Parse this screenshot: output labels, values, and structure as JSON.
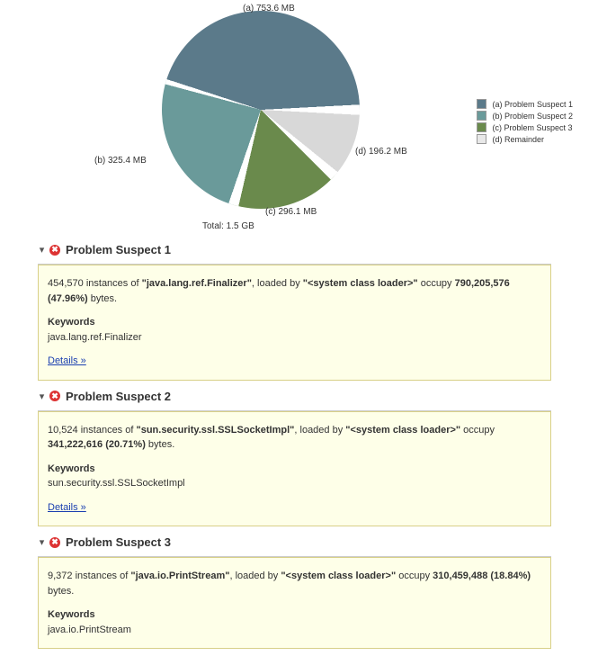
{
  "chart_data": {
    "type": "pie",
    "title": "",
    "series": [
      {
        "key": "a",
        "name": "Problem Suspect 1",
        "value_mb": 753.6,
        "label": "(a)  753.6 MB",
        "color": "#5b7a8a"
      },
      {
        "key": "b",
        "name": "Problem Suspect 2",
        "value_mb": 325.4,
        "label": "(b)  325.4 MB",
        "color": "#6a9a9a"
      },
      {
        "key": "c",
        "name": "Problem Suspect 3",
        "value_mb": 296.1,
        "label": "(c)  296.1 MB",
        "color": "#6a8a4c"
      },
      {
        "key": "d",
        "name": "Remainder",
        "value_mb": 196.2,
        "label": "(d)  196.2 MB",
        "color": "#d8d8d8"
      }
    ],
    "total_label": "Total: 1.5 GB"
  },
  "legend": {
    "items": [
      {
        "swatch": "#5b7a8a",
        "text": "(a)  Problem Suspect 1"
      },
      {
        "swatch": "#6a9a9a",
        "text": "(b)  Problem Suspect 2"
      },
      {
        "swatch": "#6a8a4c",
        "text": "(c)  Problem Suspect 3"
      },
      {
        "swatch": "#d8d8d8",
        "text": "(d)  Remainder"
      }
    ]
  },
  "suspects": [
    {
      "title": "Problem Suspect 1",
      "instances": "454,570",
      "class": "java.lang.ref.Finalizer",
      "loader": "<system class loader>",
      "bytes": "790,205,576 (47.96%)",
      "keyword": "java.lang.ref.Finalizer",
      "details": "Details »"
    },
    {
      "title": "Problem Suspect 2",
      "instances": "10,524",
      "class": "sun.security.ssl.SSLSocketImpl",
      "loader": "<system class loader>",
      "bytes": "341,222,616 (20.71%)",
      "keyword": "sun.security.ssl.SSLSocketImpl",
      "details": "Details »"
    },
    {
      "title": "Problem Suspect 3",
      "instances": "9,372",
      "class": "java.io.PrintStream",
      "loader": "<system class loader>",
      "bytes": "310,459,488 (18.84%)",
      "keyword": "java.io.PrintStream",
      "details": "Details »"
    }
  ],
  "labels": {
    "keywords": "Keywords",
    "instances_of": " instances of ",
    "loaded_by": ", loaded by ",
    "occupy": " occupy ",
    "bytes_suffix": " bytes."
  }
}
